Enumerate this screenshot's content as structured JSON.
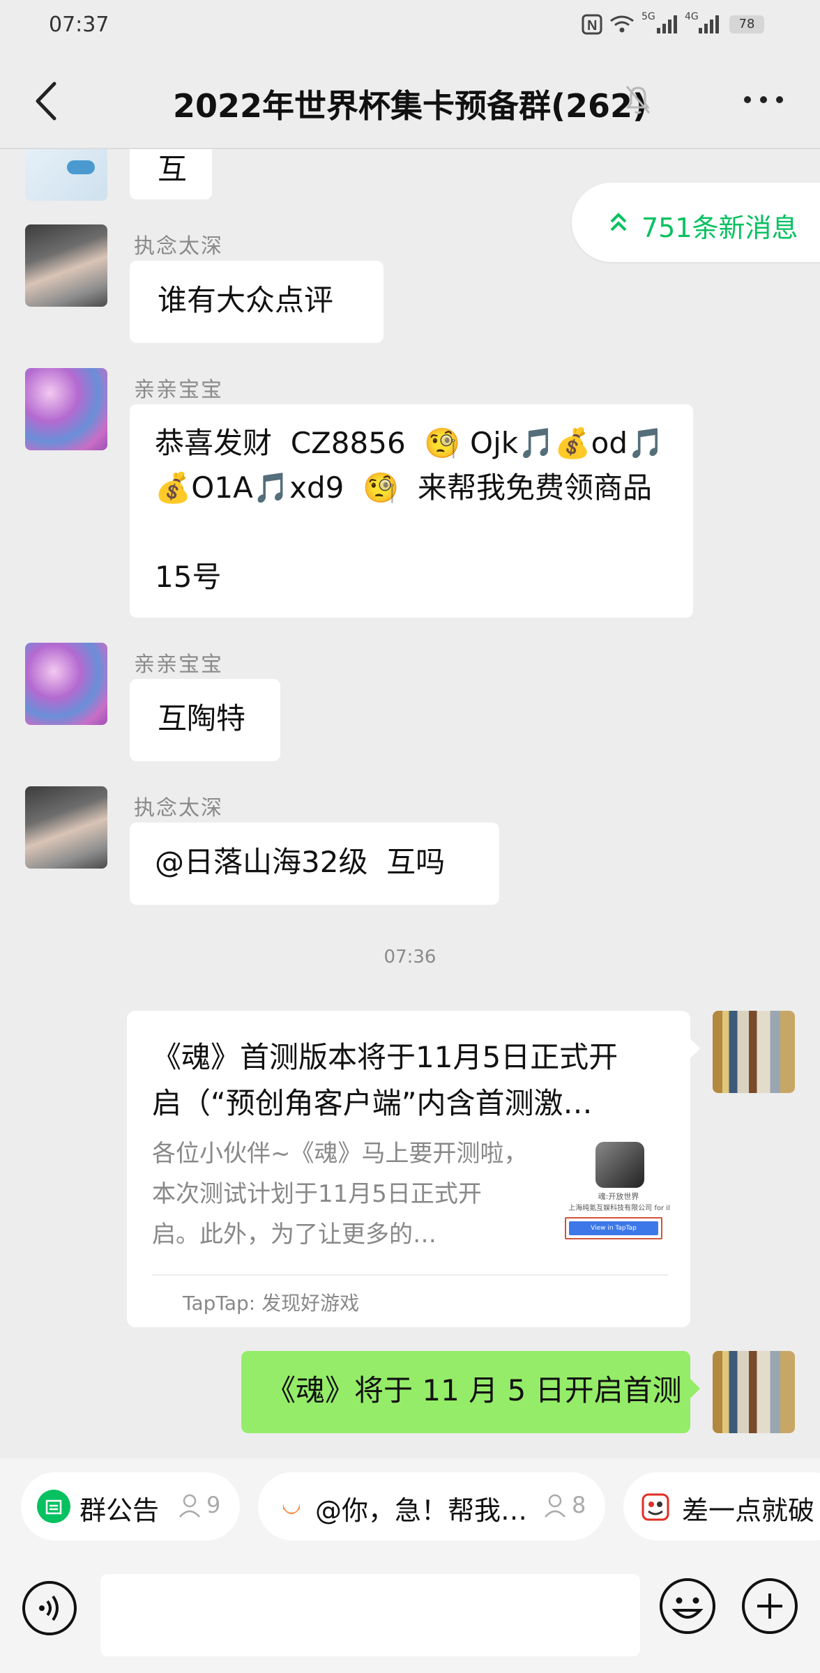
{
  "status_bar": {
    "time": "07:37",
    "network_5g": "5G",
    "network_4g": "4G",
    "battery": "78"
  },
  "header": {
    "title": "2022年世界杯集卡预备群(262)"
  },
  "new_messages": {
    "label": "751条新消息"
  },
  "messages": [
    {
      "sender": "",
      "text": "互"
    },
    {
      "sender": "执念太深",
      "text": "谁有大众点评"
    },
    {
      "sender": "亲亲宝宝",
      "text": "恭喜发财  CZ8856  🧐 Ojk🎵💰od🎵\n💰O1A🎵xd9  🧐  来帮我免费领商品\n\n15号"
    },
    {
      "sender": "亲亲宝宝",
      "text": "互陶特"
    },
    {
      "sender": "执念太深",
      "text": "@日落山海32级  互吗"
    }
  ],
  "timestamp": "07:36",
  "link_card": {
    "title": "《魂》首测版本将于11月5日正式开启（“预创角客户端”内含首测激…",
    "description": "各位小伙伴~《魂》马上要开测啦，本次测试计划于11月5日正式开启。此外，为了让更多的…",
    "thumb_title": "魂:开放世界",
    "thumb_company": "上海纯氪互娱科技有限公司 for il",
    "thumb_button": "View in TapTap",
    "source": "TapTap: 发现好游戏"
  },
  "my_message": {
    "text": "《魂》将于 11 月 5 日开启首测"
  },
  "shortcuts": [
    {
      "label": "群公告",
      "count": "9"
    },
    {
      "label": "@你，急！帮我…",
      "count": "8"
    },
    {
      "label": "差一点就破"
    }
  ],
  "input": {
    "placeholder": ""
  },
  "colors": {
    "accent": "#07c160",
    "my_bubble": "#95ec69",
    "background": "#ededed"
  }
}
